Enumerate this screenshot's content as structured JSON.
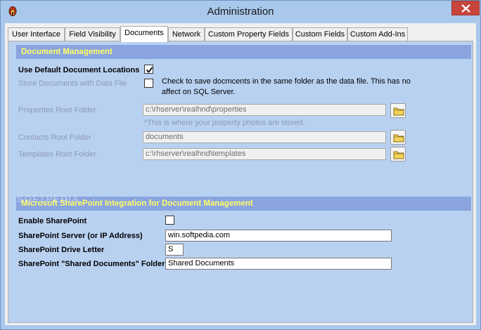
{
  "window": {
    "title": "Administration"
  },
  "tabs": [
    {
      "label": "User Interface"
    },
    {
      "label": "Field Visibility"
    },
    {
      "label": "Documents"
    },
    {
      "label": "Network"
    },
    {
      "label": "Custom Property Fields"
    },
    {
      "label": "Custom Fields"
    },
    {
      "label": "Custom Add-Ins"
    }
  ],
  "document_management": {
    "header": "Document Management",
    "use_default_label": "Use Default Document Locations",
    "use_default_checked": true,
    "store_with_data_label": "Store Documents with Data File",
    "store_with_data_checked": false,
    "store_note": "Check to save docmcents in the same folder as the data file.  This has no affect on SQL Server.",
    "properties_label": "Properties Root Folder",
    "properties_value": "c:\\rhserver\\realhnd\\properties",
    "properties_hint": "*This is where your property photos are stored.",
    "contacts_label": "Contacts Root Folder",
    "contacts_value": "documents",
    "templates_label": "Templates Root Folder",
    "templates_value": "c:\\rhserver\\realhnd\\templates"
  },
  "sharepoint": {
    "header": "Microsoft SharePoint Integration for Document Management",
    "enable_label": "Enable SharePoint",
    "enable_checked": false,
    "server_label": "SharePoint Server (or IP Address)",
    "server_value": "win.softpedia.com",
    "drive_label": "SharePoint Drive Letter",
    "drive_value": "S",
    "folder_label": "SharePoint \"Shared Documents\" Folder",
    "folder_value": "Shared Documents"
  },
  "watermark": "SOFTPEDIA",
  "colors": {
    "section_header": "#8aa4e0",
    "header_text": "#ffff66",
    "panel": "#b9d1f1",
    "close": "#c7453b"
  },
  "icons": {
    "app": "app-icon",
    "close": "close-icon",
    "folder": "folder-icon",
    "check": "check-icon"
  }
}
